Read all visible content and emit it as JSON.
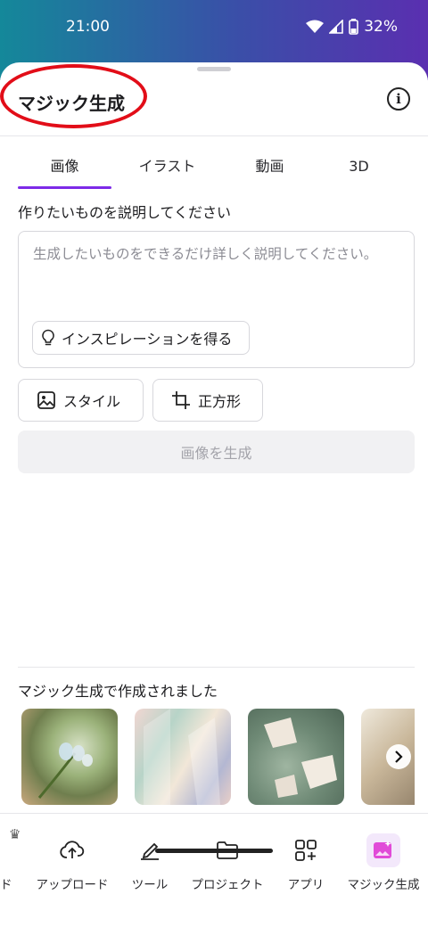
{
  "status": {
    "time": "21:00",
    "battery": "32%"
  },
  "header": {
    "title": "マジック生成"
  },
  "tabs": [
    "画像",
    "イラスト",
    "動画",
    "3D"
  ],
  "prompt": {
    "label": "作りたいものを説明してください",
    "placeholder": "生成したいものをできるだけ詳しく説明してください。",
    "inspiration_button": "インスピレーションを得る"
  },
  "options": {
    "style_label": "スタイル",
    "aspect_label": "正方形"
  },
  "generate_button": "画像を生成",
  "gallery": {
    "label": "マジック生成で作成されました"
  },
  "nav": {
    "items": [
      {
        "label": "ンド",
        "icon": "home-icon"
      },
      {
        "label": "アップロード",
        "icon": "cloud-upload-icon"
      },
      {
        "label": "ツール",
        "icon": "pen-tool-icon"
      },
      {
        "label": "プロジェクト",
        "icon": "folder-icon"
      },
      {
        "label": "アプリ",
        "icon": "apps-grid-icon"
      },
      {
        "label": "マジック生成",
        "icon": "magic-image-icon"
      }
    ]
  },
  "colors": {
    "accent": "#7d2ae8",
    "annotation": "#e20d18",
    "magic": "#e14bd8"
  }
}
